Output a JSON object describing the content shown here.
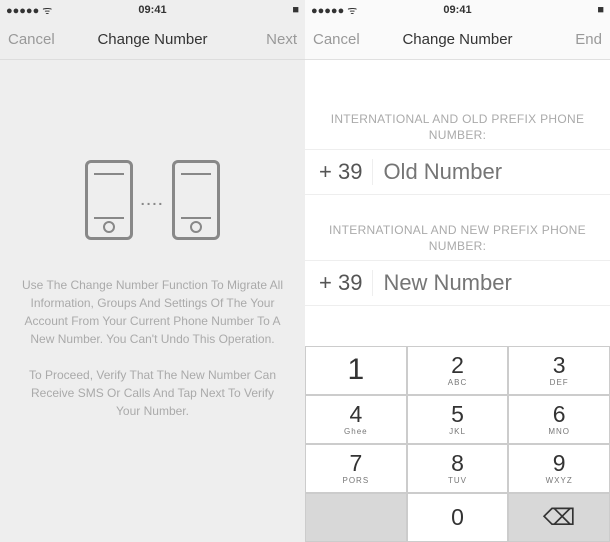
{
  "status": {
    "signal": "●●●●●",
    "wifi": "ᯤ",
    "time": "09:41",
    "battery": "■"
  },
  "left": {
    "nav": {
      "cancel": "Cancel",
      "title": "Change Number",
      "next": "Next"
    },
    "dots": "....",
    "para1": "Use The Change Number Function To Migrate All Information, Groups And Settings Of The Your Account From Your Current Phone Number To A New Number. You Can't Undo This Operation.",
    "para2": "To Proceed, Verify That The New Number Can Receive SMS Or Calls And Tap Next To Verify Your Number."
  },
  "right": {
    "nav": {
      "cancel": "Cancel",
      "title": "Change Number",
      "end": "End"
    },
    "old_label": "INTERNATIONAL AND OLD PREFIX PHONE NUMBER:",
    "old_prefix": "+ 39",
    "old_placeholder": "Old Number",
    "new_label": "INTERNATIONAL AND NEW PREFIX PHONE NUMBER:",
    "new_prefix": "+ 39",
    "new_placeholder": "New Number"
  },
  "keypad": {
    "k1": {
      "n": "1",
      "s": ""
    },
    "k2": {
      "n": "2",
      "s": "ABC"
    },
    "k3": {
      "n": "3",
      "s": "DEF"
    },
    "k4": {
      "n": "4",
      "s": "Ghee"
    },
    "k5": {
      "n": "5",
      "s": "JKL"
    },
    "k6": {
      "n": "6",
      "s": "MNO"
    },
    "k7": {
      "n": "7",
      "s": "PORS"
    },
    "k8": {
      "n": "8",
      "s": "TUV"
    },
    "k9": {
      "n": "9",
      "s": "WXYZ"
    },
    "k0": {
      "n": "0",
      "s": ""
    },
    "del": "⌫"
  }
}
